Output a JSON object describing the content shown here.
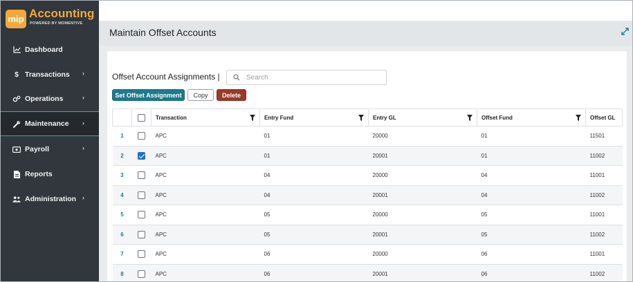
{
  "app": {
    "logo_badge": "mip",
    "logo_title": "Accounting",
    "logo_subtitle": "POWERED BY MOMENTIVE",
    "brand_color": "#f2a93b"
  },
  "sidebar": {
    "items": [
      {
        "label": "Dashboard",
        "icon": "chart-line-icon",
        "has_submenu": false
      },
      {
        "label": "Transactions",
        "icon": "dollar-icon",
        "has_submenu": true
      },
      {
        "label": "Operations",
        "icon": "gears-icon",
        "has_submenu": true
      },
      {
        "label": "Maintenance",
        "icon": "wrench-icon",
        "has_submenu": true,
        "active": true
      },
      {
        "label": "Payroll",
        "icon": "money-icon",
        "has_submenu": true
      },
      {
        "label": "Reports",
        "icon": "report-icon",
        "has_submenu": false
      },
      {
        "label": "Administration",
        "icon": "users-icon",
        "has_submenu": true
      }
    ]
  },
  "header": {
    "page_title": "Maintain Offset Accounts"
  },
  "main": {
    "section_title": "Offset Account Assignments",
    "search_placeholder": "Search",
    "buttons": {
      "set_offset": "Set Offset Assignment",
      "copy": "Copy",
      "delete": "Delete"
    },
    "columns": [
      "Transaction",
      "Entry Fund",
      "Entry GL",
      "Offset Fund",
      "Offset GL"
    ],
    "rows": [
      {
        "num": "1",
        "checked": false,
        "transaction": "APC",
        "entry_fund": "01",
        "entry_gl": "20000",
        "offset_fund": "01",
        "offset_gl": "11501"
      },
      {
        "num": "2",
        "checked": true,
        "transaction": "APC",
        "entry_fund": "01",
        "entry_gl": "20001",
        "offset_fund": "01",
        "offset_gl": "11002"
      },
      {
        "num": "3",
        "checked": false,
        "transaction": "APC",
        "entry_fund": "04",
        "entry_gl": "20000",
        "offset_fund": "04",
        "offset_gl": "11001"
      },
      {
        "num": "4",
        "checked": false,
        "transaction": "APC",
        "entry_fund": "04",
        "entry_gl": "20001",
        "offset_fund": "04",
        "offset_gl": "11002"
      },
      {
        "num": "5",
        "checked": false,
        "transaction": "APC",
        "entry_fund": "05",
        "entry_gl": "20000",
        "offset_fund": "05",
        "offset_gl": "11001"
      },
      {
        "num": "6",
        "checked": false,
        "transaction": "APC",
        "entry_fund": "05",
        "entry_gl": "20001",
        "offset_fund": "05",
        "offset_gl": "11002"
      },
      {
        "num": "7",
        "checked": false,
        "transaction": "APC",
        "entry_fund": "06",
        "entry_gl": "20000",
        "offset_fund": "06",
        "offset_gl": "11001"
      },
      {
        "num": "8",
        "checked": false,
        "transaction": "APC",
        "entry_fund": "06",
        "entry_gl": "20001",
        "offset_fund": "06",
        "offset_gl": "11002"
      }
    ]
  },
  "colors": {
    "sidebar_bg": "#31373c",
    "accent": "#1d7a8c",
    "delete": "#9b3a2a",
    "checkbox_checked": "#1a73c9"
  }
}
